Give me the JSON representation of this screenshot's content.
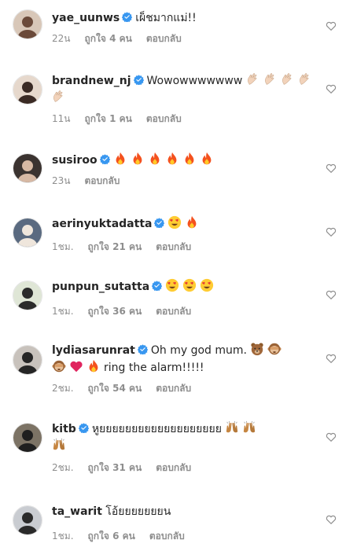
{
  "comments": [
    {
      "username": "yae_uunws",
      "verified": true,
      "text": "เผ็ชมากแม่!!",
      "emojis_before": [],
      "emojis_after": [],
      "time": "22น",
      "likes": "ถูกใจ 4 คน",
      "reply": "ตอบกลับ"
    },
    {
      "username": "brandnew_nj",
      "verified": true,
      "text": "Wowowwwwwww",
      "emojis_inline": [
        "clap",
        "clap",
        "clap",
        "clap",
        "clap"
      ],
      "time": "11น",
      "likes": "ถูกใจ 1 คน",
      "reply": "ตอบกลับ"
    },
    {
      "username": "susiroo",
      "verified": true,
      "text": "",
      "emojis_inline": [
        "fire",
        "fire",
        "fire",
        "fire",
        "fire",
        "fire"
      ],
      "time": "23น",
      "likes": "",
      "reply": "ตอบกลับ"
    },
    {
      "username": "aerinyuktadatta",
      "verified": true,
      "text": "",
      "emojis_inline": [
        "heart-eyes",
        "fire"
      ],
      "time": "1ชม.",
      "likes": "ถูกใจ 21 คน",
      "reply": "ตอบกลับ"
    },
    {
      "username": "punpun_sutatta",
      "verified": true,
      "text": "",
      "emojis_inline": [
        "heart-eyes",
        "heart-eyes",
        "heart-eyes"
      ],
      "time": "1ชม.",
      "likes": "ถูกใจ 36 คน",
      "reply": "ตอบกลับ"
    },
    {
      "username": "lydiasarunrat",
      "verified": true,
      "text": "Oh my god mum.",
      "text2": "ring the alarm!!!!!",
      "emojis_inline": [
        "bear",
        "see-no-evil-monkey"
      ],
      "emojis_line2": [
        "see-no-evil-monkey",
        "red-heart",
        "fire"
      ],
      "time": "2ชม.",
      "likes": "ถูกใจ 54 คน",
      "reply": "ตอบกลับ"
    },
    {
      "username": "kitb",
      "verified": true,
      "text": "หูยยยยยยยยยยยยยยยยยยย",
      "emojis_inline": [
        "raised-hands",
        "raised-hands"
      ],
      "emojis_line2": [
        "raised-hands"
      ],
      "time": "2ชม.",
      "likes": "ถูกใจ 31 คน",
      "reply": "ตอบกลับ"
    },
    {
      "username": "ta_warit",
      "verified": false,
      "text": "โอ้ยยยยยยยน",
      "emojis_inline": [],
      "time": "1ชม.",
      "likes": "ถูกใจ 6 คน",
      "reply": "ตอบกลับ"
    }
  ],
  "colors": {
    "verified": "#3897f0",
    "meta": "#8e8e8e",
    "text": "#262626"
  }
}
